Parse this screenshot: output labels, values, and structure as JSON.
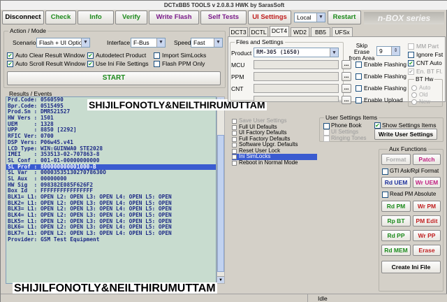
{
  "window": {
    "title": "DCTxBB5 TOOLS v 2.0.8.3 HWK by SarasSoft"
  },
  "toolbar": {
    "disconnect": "Disconnect",
    "check": "Check",
    "info": "Info",
    "verify": "Verify",
    "write_flash": "Write Flash",
    "self_tests": "Self Tests",
    "ui_settings": "UI Settings",
    "local_select": "Local",
    "restart": "Restart",
    "brand": "n-BOX series"
  },
  "action_mode": {
    "group_title": "Action / Mode",
    "scenario_label": "Scenario",
    "scenario_value": "Flash + UI Options",
    "interface_label": "Interface",
    "interface_value": "F-Bus",
    "speed_label": "Speed",
    "speed_value": "Fast",
    "checks": [
      {
        "label": "Auto Clear Result Window",
        "checked": true
      },
      {
        "label": "Autodetect Product",
        "checked": true
      },
      {
        "label": "Import SimLocks",
        "checked": false
      },
      {
        "label": "Auto Scroll Result Window",
        "checked": true
      },
      {
        "label": "Use Ini File Settings",
        "checked": true
      },
      {
        "label": "Flash PPM Only",
        "checked": false
      }
    ],
    "start_label": "START"
  },
  "results": {
    "title": "Results / Events",
    "lines": [
      "Prd.Code: 0560590",
      "Bpr.Code: 0515495",
      "Prod.Sn : DMR521527",
      "HW Vers : 1501",
      "UEM     : 1328",
      "UPP     : 8850 [2292]",
      "RFIC Ver: 0700",
      "DSP Vers: P06w45.v41",
      "LCD Type: WIN:GUINWA0 STE2028",
      "IMEI    : 353513-02-707863-8",
      "SL Conf : 001-01-00000000000",
      "SL Prof : 800000000001000-B",
      "SL Var  : 0000353513027078630O",
      "SL Aux  : 00000000",
      "HW Sig  : 098382E085F626F2",
      "Box Id  : FFFFFFFFFFFFFFFF",
      "BLK1= L1: OPEN L2: OPEN L3: OPEN L4: OPEN L5: OPEN",
      "BLK2= L1: OPEN L2: OPEN L3: OPEN L4: OPEN L5: OPEN",
      "BLK3= L1: OPEN L2: OPEN L3: OPEN L4: OPEN L5: OPEN",
      "BLK4= L1: OPEN L2: OPEN L3: OPEN L4: OPEN L5: OPEN",
      "BLK5= L1: OPEN L2: OPEN L3: OPEN L4: OPEN L5: OPEN",
      "BLK6= L1: OPEN L2: OPEN L3: OPEN L4: OPEN L5: OPEN",
      "BLK7= L1: OPEN L2: OPEN L3: OPEN L4: OPEN L5: OPEN",
      "Provider: GSM Test Equipment"
    ],
    "highlighted_index": 11
  },
  "watermark_top": "SHIJILFONOTLY&NEILTHIRUMUTTAM",
  "watermark_bottom": "SHIJILFONOTLY&NEILTHIRUMUTTAM",
  "tabs": [
    "DCT3",
    "DCTL",
    "DCT4",
    "WD2",
    "BB5",
    "UFSx"
  ],
  "active_tab": "DCT4",
  "files": {
    "group_title": "Files and Settings",
    "product_label": "Product",
    "product_value": "RM-305 (1650)",
    "rows": [
      "MCU",
      "PPM",
      "CNT",
      ""
    ],
    "browse": "...",
    "enable_labels": [
      "Enable Flashing",
      "Enable Flashing",
      "Enable Flashing",
      "Enable Upload"
    ],
    "skip_erase_label": "Skip Erase from Area",
    "skip_erase_value": "9",
    "mm_part": "MM Part",
    "ignore_fst": "Ignore Fst",
    "cnt_auto": "CNT Auto",
    "en_bt_fl": "En. BT Fl.",
    "bt_hw_title": "BT Hw",
    "bt_hw_opts": [
      "Auto",
      "Old",
      "New"
    ]
  },
  "ui_list": {
    "items": [
      "Save User Settings",
      "Full UI Defaults",
      "UI Factory Defaults",
      "Full Factory Defaults",
      "Software Upgr. Defaults",
      "Reset User Lock",
      "Ini SimLocks",
      "Reboot in Normal Mode"
    ],
    "selected_index": 6
  },
  "user_settings": {
    "group_title": "User Settings Items",
    "items": [
      "Phone Book",
      "UI Settings",
      "Ringing Tones"
    ],
    "show_items": "Show Settings Items",
    "write_button": "Write User Settings"
  },
  "aux": {
    "group_title": "Aux Functions",
    "format": "Format",
    "patch": "Patch",
    "gti": "GTI Ask/Rpl Format",
    "rd_uem": "Rd UEM",
    "wr_uem": "Wr UEM",
    "read_pm_absolute": "Read PM Absolute",
    "rd_pm": "Rd PM",
    "wr_pm": "Wr PM",
    "rp_bt": "Rp BT",
    "pm_edit": "PM Edit",
    "rd_pp": "Rd PP",
    "wr_pp": "Wr PP",
    "rd_mem": "Rd MEM",
    "erase": "Erase",
    "create_ini": "Create Ini File"
  },
  "status": {
    "text": "Idle"
  }
}
